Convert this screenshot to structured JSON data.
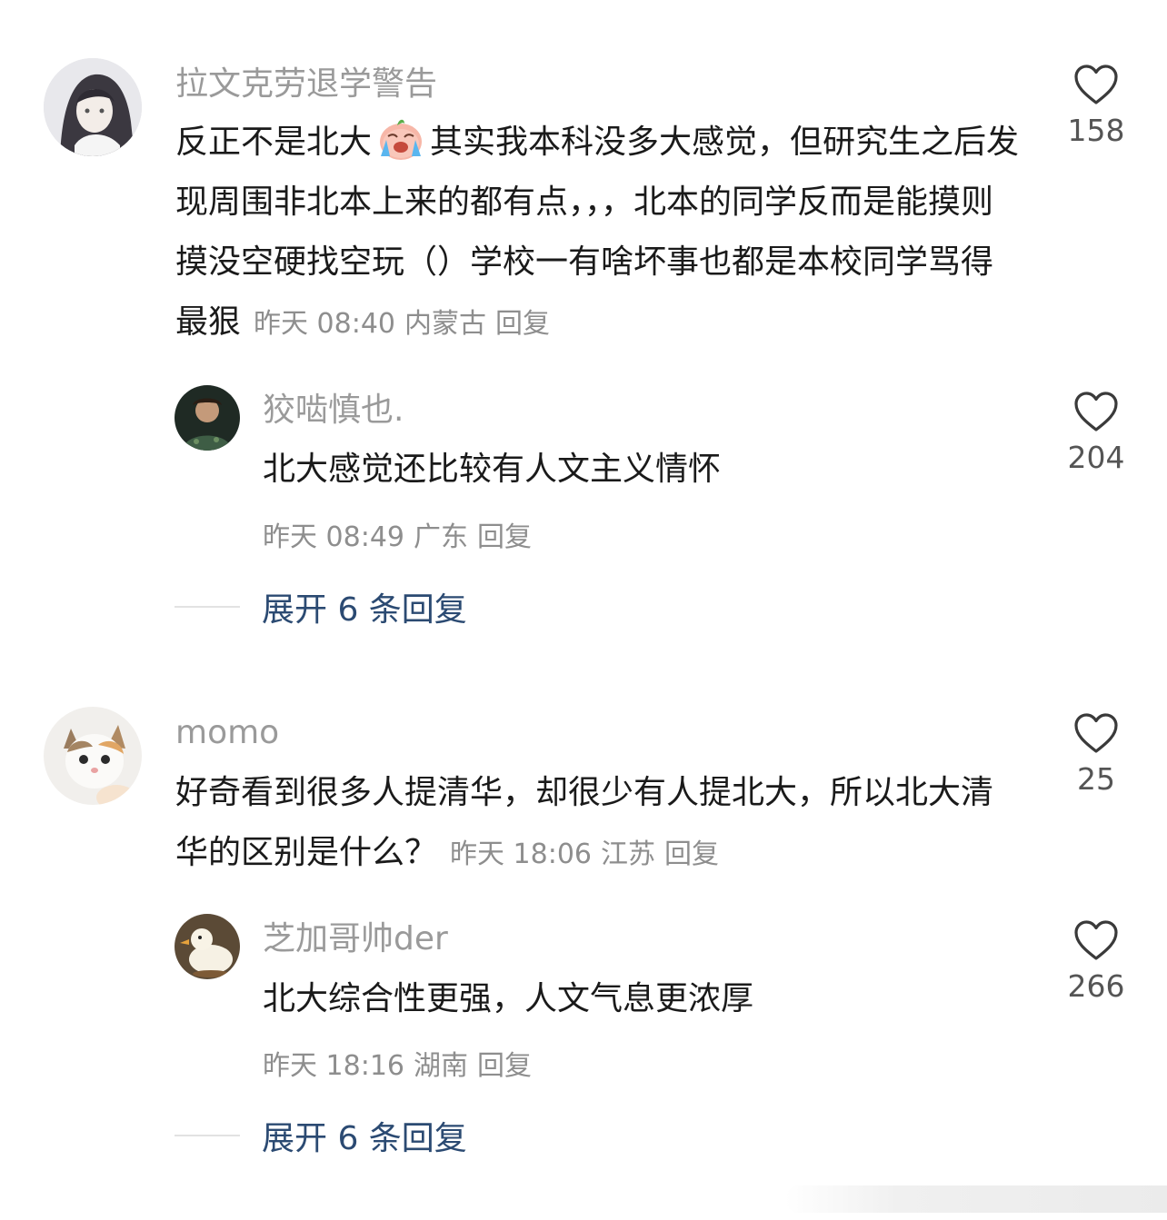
{
  "comments": [
    {
      "username": "拉文克劳退学警告",
      "text_before_emoji": "反正不是北大",
      "emoji": "crying-face-emoji",
      "text_after_emoji": "其实我本科没多大感觉，但研究生之后发现周围非北本上来的都有点，，，北本的同学反而是能摸则摸没空硬找空玩（）学校一有啥坏事也都是本校同学骂得最狠",
      "time": "昨天 08:40",
      "location": "内蒙古",
      "reply_label": "回复",
      "likes": "158",
      "reply": {
        "username": "狡啮慎也.",
        "text": "北大感觉还比较有人文主义情怀",
        "time": "昨天 08:49",
        "location": "广东",
        "reply_label": "回复",
        "likes": "204"
      },
      "expand_label": "展开 6 条回复"
    },
    {
      "username": "momo",
      "text": "好奇看到很多人提清华，却很少有人提北大，所以北大清华的区别是什么？",
      "time": "昨天 18:06",
      "location": "江苏",
      "reply_label": "回复",
      "likes": "25",
      "reply": {
        "username": "芝加哥帅der",
        "text": "北大综合性更强，人文气息更浓厚",
        "time": "昨天 18:16",
        "location": "湖南",
        "reply_label": "回复",
        "likes": "266"
      },
      "expand_label": "展开 6 条回复"
    }
  ],
  "colors": {
    "username": "#9a9a9a",
    "content": "#1a1a1a",
    "meta": "#8e8e8e",
    "expand_link": "#2b4a72",
    "heart_stroke": "#3a3a3a"
  }
}
